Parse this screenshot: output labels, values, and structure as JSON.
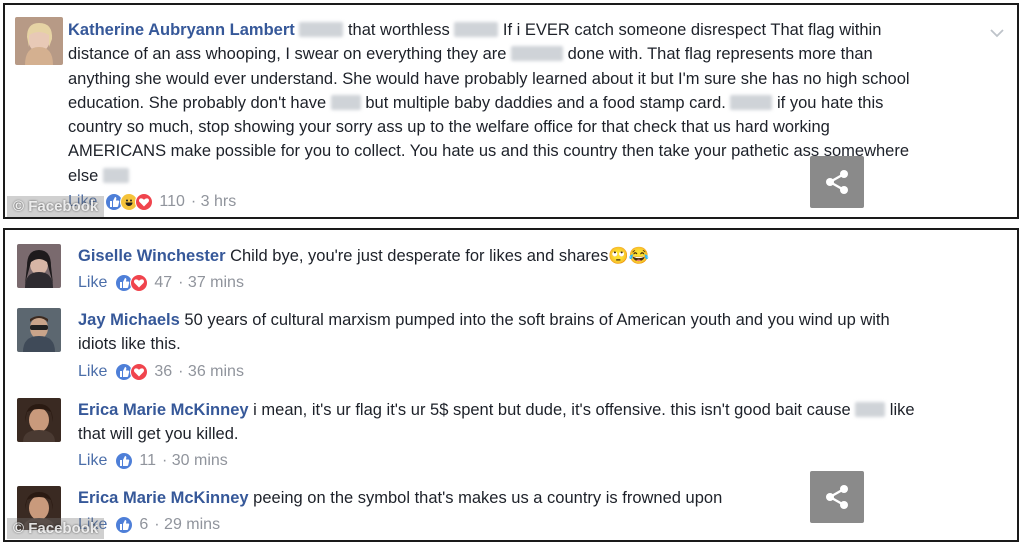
{
  "top_post": {
    "author": "Katherine Aubryann Lambert",
    "lines": [
      [
        {
          "t": "txt",
          "v": " "
        },
        {
          "t": "blur",
          "w": 44
        },
        {
          "t": "txt",
          "v": " that worthless "
        },
        {
          "t": "blur",
          "w": 44
        },
        {
          "t": "txt",
          "v": "  If i EVER catch someone disrespect That flag within"
        }
      ],
      [
        {
          "t": "txt",
          "v": "distance of an ass whooping, I swear on everything they are "
        },
        {
          "t": "blur",
          "w": 52
        },
        {
          "t": "txt",
          "v": " done with. That flag represents more than"
        }
      ],
      [
        {
          "t": "txt",
          "v": "anything she would ever understand. She would have probably learned about it but I'm sure she has no high school"
        }
      ],
      [
        {
          "t": "txt",
          "v": "education. She probably don't have "
        },
        {
          "t": "blur",
          "w": 30
        },
        {
          "t": "txt",
          "v": " but multiple baby daddies and a food stamp card. "
        },
        {
          "t": "blur",
          "w": 42
        },
        {
          "t": "txt",
          "v": "  if you hate this"
        }
      ],
      [
        {
          "t": "txt",
          "v": "country so much, stop showing your sorry ass up to the welfare office for that check that us hard working"
        }
      ],
      [
        {
          "t": "txt",
          "v": "AMERICANS make possible for you to collect. You hate us and this country then take your pathetic ass somewhere"
        }
      ],
      [
        {
          "t": "txt",
          "v": "else "
        },
        {
          "t": "blur",
          "w": 26
        }
      ]
    ],
    "like_label": "Like",
    "reaction_count": "110",
    "time": "· 3 hrs"
  },
  "comments": [
    {
      "author": "Giselle Winchester",
      "lines": [
        [
          {
            "t": "txt",
            "v": " Child bye, you're just desperate for likes and shares"
          },
          {
            "t": "emoji",
            "v": "🙄😂"
          }
        ]
      ],
      "like_label": "Like",
      "reaction_count": "47",
      "time": "· 37 mins"
    },
    {
      "author": "Jay Michaels",
      "lines": [
        [
          {
            "t": "txt",
            "v": " 50 years of cultural marxism pumped into the soft brains of American youth and you wind up with"
          }
        ],
        [
          {
            "t": "txt",
            "v": "idiots like this."
          }
        ]
      ],
      "like_label": "Like",
      "reaction_count": "36",
      "time": "· 36 mins"
    },
    {
      "author": "Erica Marie McKinney",
      "lines": [
        [
          {
            "t": "txt",
            "v": " i mean, it's ur flag it's ur 5$ spent but dude, it's offensive. this isn't good bait cause "
          },
          {
            "t": "blur",
            "w": 30
          },
          {
            "t": "txt",
            "v": " like"
          }
        ],
        [
          {
            "t": "txt",
            "v": "that will get you killed."
          }
        ]
      ],
      "like_label": "Like",
      "reaction_count": "11",
      "time": "· 30 mins"
    },
    {
      "author": "Erica Marie McKinney",
      "lines": [
        [
          {
            "t": "txt",
            "v": " peeing on the symbol that's makes us a country is frowned upon"
          }
        ]
      ],
      "like_label": "Like",
      "reaction_count": "6",
      "time": "· 29 mins"
    }
  ],
  "watermark": "© Facebook",
  "icons": {
    "share": "share-icon",
    "chevron": "chevron-down-icon",
    "like_reaction": "like-reaction-icon",
    "love_reaction": "love-reaction-icon",
    "haha_reaction": "haha-reaction-icon"
  },
  "colors": {
    "name": "#365899",
    "link": "#4b6ea9",
    "meta": "#90949c",
    "like": "#4e7fd8",
    "love": "#f0444d",
    "haha": "#f5c33b",
    "share_bg": "#8a8a8a"
  }
}
